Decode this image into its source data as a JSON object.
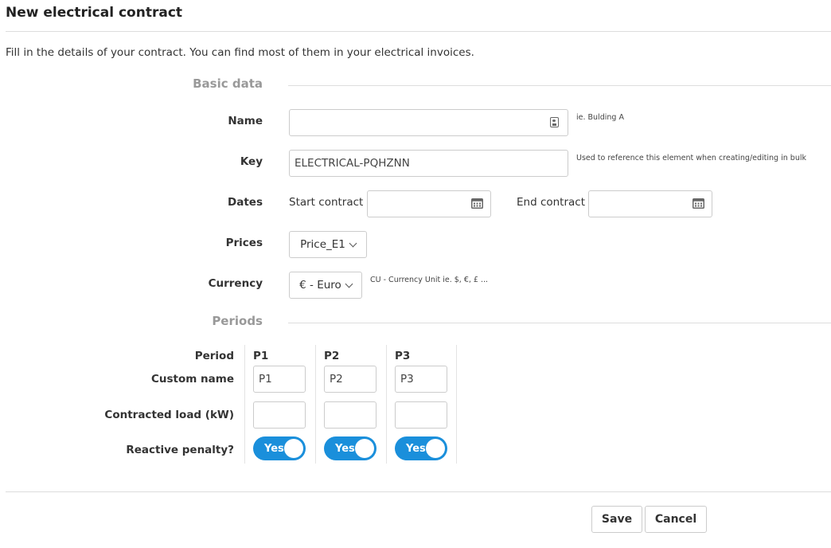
{
  "header": {
    "title": "New electrical contract"
  },
  "intro": "Fill in the details of your contract. You can find most of them in your electrical invoices.",
  "basic": {
    "section_title": "Basic data",
    "name": {
      "label": "Name",
      "value": "",
      "help": "ie. Bulding A"
    },
    "key": {
      "label": "Key",
      "value": "ELECTRICAL-PQHZNN",
      "help": "Used to reference this element when creating/editing in bulk"
    },
    "dates": {
      "label": "Dates",
      "start_label": "Start contract",
      "end_label": "End contract",
      "start_value": "",
      "end_value": ""
    },
    "prices": {
      "label": "Prices",
      "selected": "Price_E1"
    },
    "currency": {
      "label": "Currency",
      "selected": "€ - Euro",
      "help": "CU - Currency Unit ie. $, €, £ ..."
    }
  },
  "periods": {
    "section_title": "Periods",
    "row_labels": {
      "period": "Period",
      "custom_name": "Custom name",
      "contracted_load": "Contracted load (kW)",
      "reactive_penalty": "Reactive penalty?"
    },
    "columns": [
      {
        "period": "P1",
        "custom_name": "P1",
        "contracted_load": "",
        "reactive_penalty": "Yes"
      },
      {
        "period": "P2",
        "custom_name": "P2",
        "contracted_load": "",
        "reactive_penalty": "Yes"
      },
      {
        "period": "P3",
        "custom_name": "P3",
        "contracted_load": "",
        "reactive_penalty": "Yes"
      }
    ]
  },
  "footer": {
    "save_label": "Save",
    "cancel_label": "Cancel"
  },
  "colors": {
    "accent": "#1a8fdb"
  }
}
